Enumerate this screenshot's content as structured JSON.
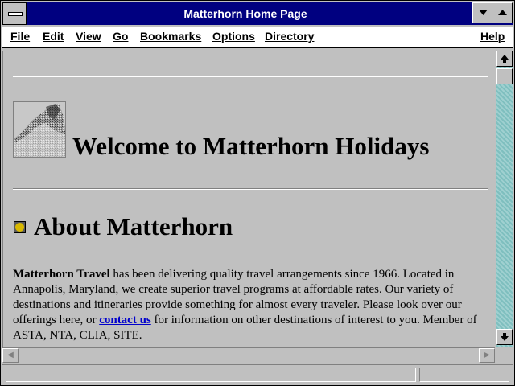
{
  "window": {
    "title": "Matterhorn Home Page"
  },
  "menubar": {
    "items": [
      {
        "label": "File"
      },
      {
        "label": "Edit"
      },
      {
        "label": "View"
      },
      {
        "label": "Go"
      },
      {
        "label": "Bookmarks"
      },
      {
        "label": "Options"
      },
      {
        "label": "Directory"
      }
    ],
    "help_label": "Help"
  },
  "page": {
    "heading": "Welcome to Matterhorn Holidays",
    "section_heading": "About Matterhorn",
    "paragraph": {
      "company": "Matterhorn Travel",
      "text_before_link": " has been delivering quality travel arrangements since 1966. Located in Annapolis, Maryland, we create superior travel programs at affordable rates. Our variety of destinations and itineraries provide something for almost every traveler. Please look over our offerings here, or ",
      "link": "contact us",
      "text_after_link": " for information on other destinations of interest to you. Member of ASTA, NTA, CLIA, SITE."
    }
  },
  "icons": {
    "system_menu": "system-menu-icon",
    "minimize": "minimize-icon",
    "maximize": "maximize-icon",
    "scroll_up": "arrow-up-icon",
    "scroll_down": "arrow-down-icon",
    "scroll_left": "arrow-left-icon",
    "scroll_right": "arrow-right-icon",
    "logo": "mountain-logo-icon",
    "bullet": "gold-ball-bullet-icon"
  },
  "colors": {
    "titlebar": "#000080",
    "desktop": "#008080",
    "link": "#0000cc",
    "bullet": "#d8b800"
  }
}
